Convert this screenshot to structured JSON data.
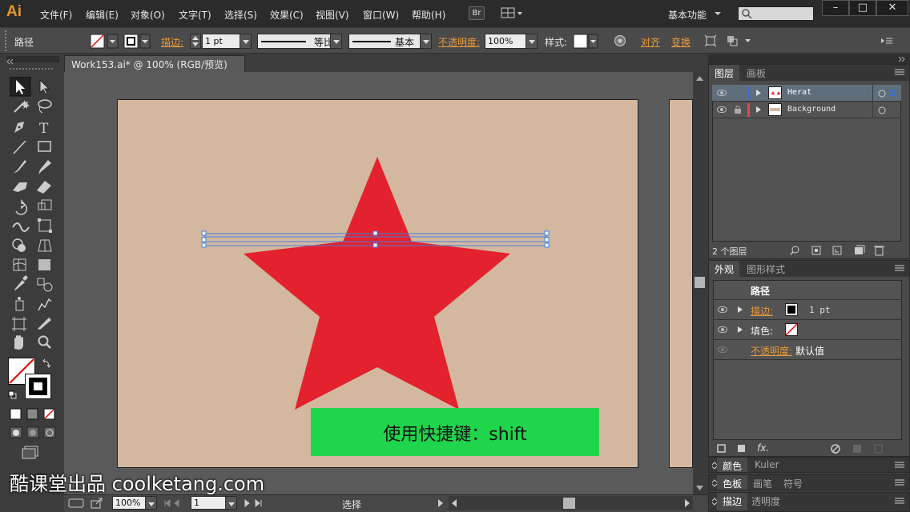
{
  "app": {
    "logo": "Ai"
  },
  "menu": {
    "items": [
      "文件(F)",
      "编辑(E)",
      "对象(O)",
      "文字(T)",
      "选择(S)",
      "效果(C)",
      "视图(V)",
      "窗口(W)",
      "帮助(H)"
    ],
    "bridge": "Br",
    "workspace": "基本功能",
    "search_placeholder": ""
  },
  "window": {
    "minimize": "–",
    "maximize": "□",
    "close": "✕"
  },
  "control": {
    "selection_type": "路径",
    "stroke_label": "描边:",
    "stroke_weight": "1 pt",
    "profile": "等比",
    "brush": "基本",
    "opacity_label": "不透明度:",
    "opacity_value": "100%",
    "style_label": "样式:",
    "align_label": "对齐",
    "transform_label": "变换"
  },
  "document": {
    "tab_title": "Work153.ai* @ 100% (RGB/预览)",
    "close": "×"
  },
  "artwork": {
    "star_color": "#e3222d",
    "artboard_color": "#d3b89f"
  },
  "caption": {
    "text": "使用快捷键：shift",
    "color": "#1fd54b"
  },
  "watermark": {
    "text": "酷课堂出品 coolketang.com"
  },
  "status": {
    "zoom": "100%",
    "artboard": "1",
    "tool": "选择"
  },
  "layers_panel": {
    "tabs": [
      "图层",
      "画板"
    ],
    "layers": [
      {
        "name": "Herat",
        "color": "#3a6fd8",
        "selected": true
      },
      {
        "name": "Background",
        "color": "#e04a4a",
        "locked": true
      }
    ],
    "count": "2 个图层"
  },
  "appearance_panel": {
    "tabs": [
      "外观",
      "图形样式"
    ],
    "title": "路径",
    "rows": [
      {
        "label": "描边:",
        "value": "1 pt"
      },
      {
        "label": "填色:",
        "value": ""
      },
      {
        "label": "不透明度:",
        "value": "默认值"
      }
    ],
    "fx": "fx."
  },
  "collapsed_panels": {
    "row1": [
      "颜色",
      "Kuler"
    ],
    "row2": [
      "色板",
      "画笔",
      "符号"
    ],
    "row3": [
      "描边",
      "透明度"
    ]
  }
}
